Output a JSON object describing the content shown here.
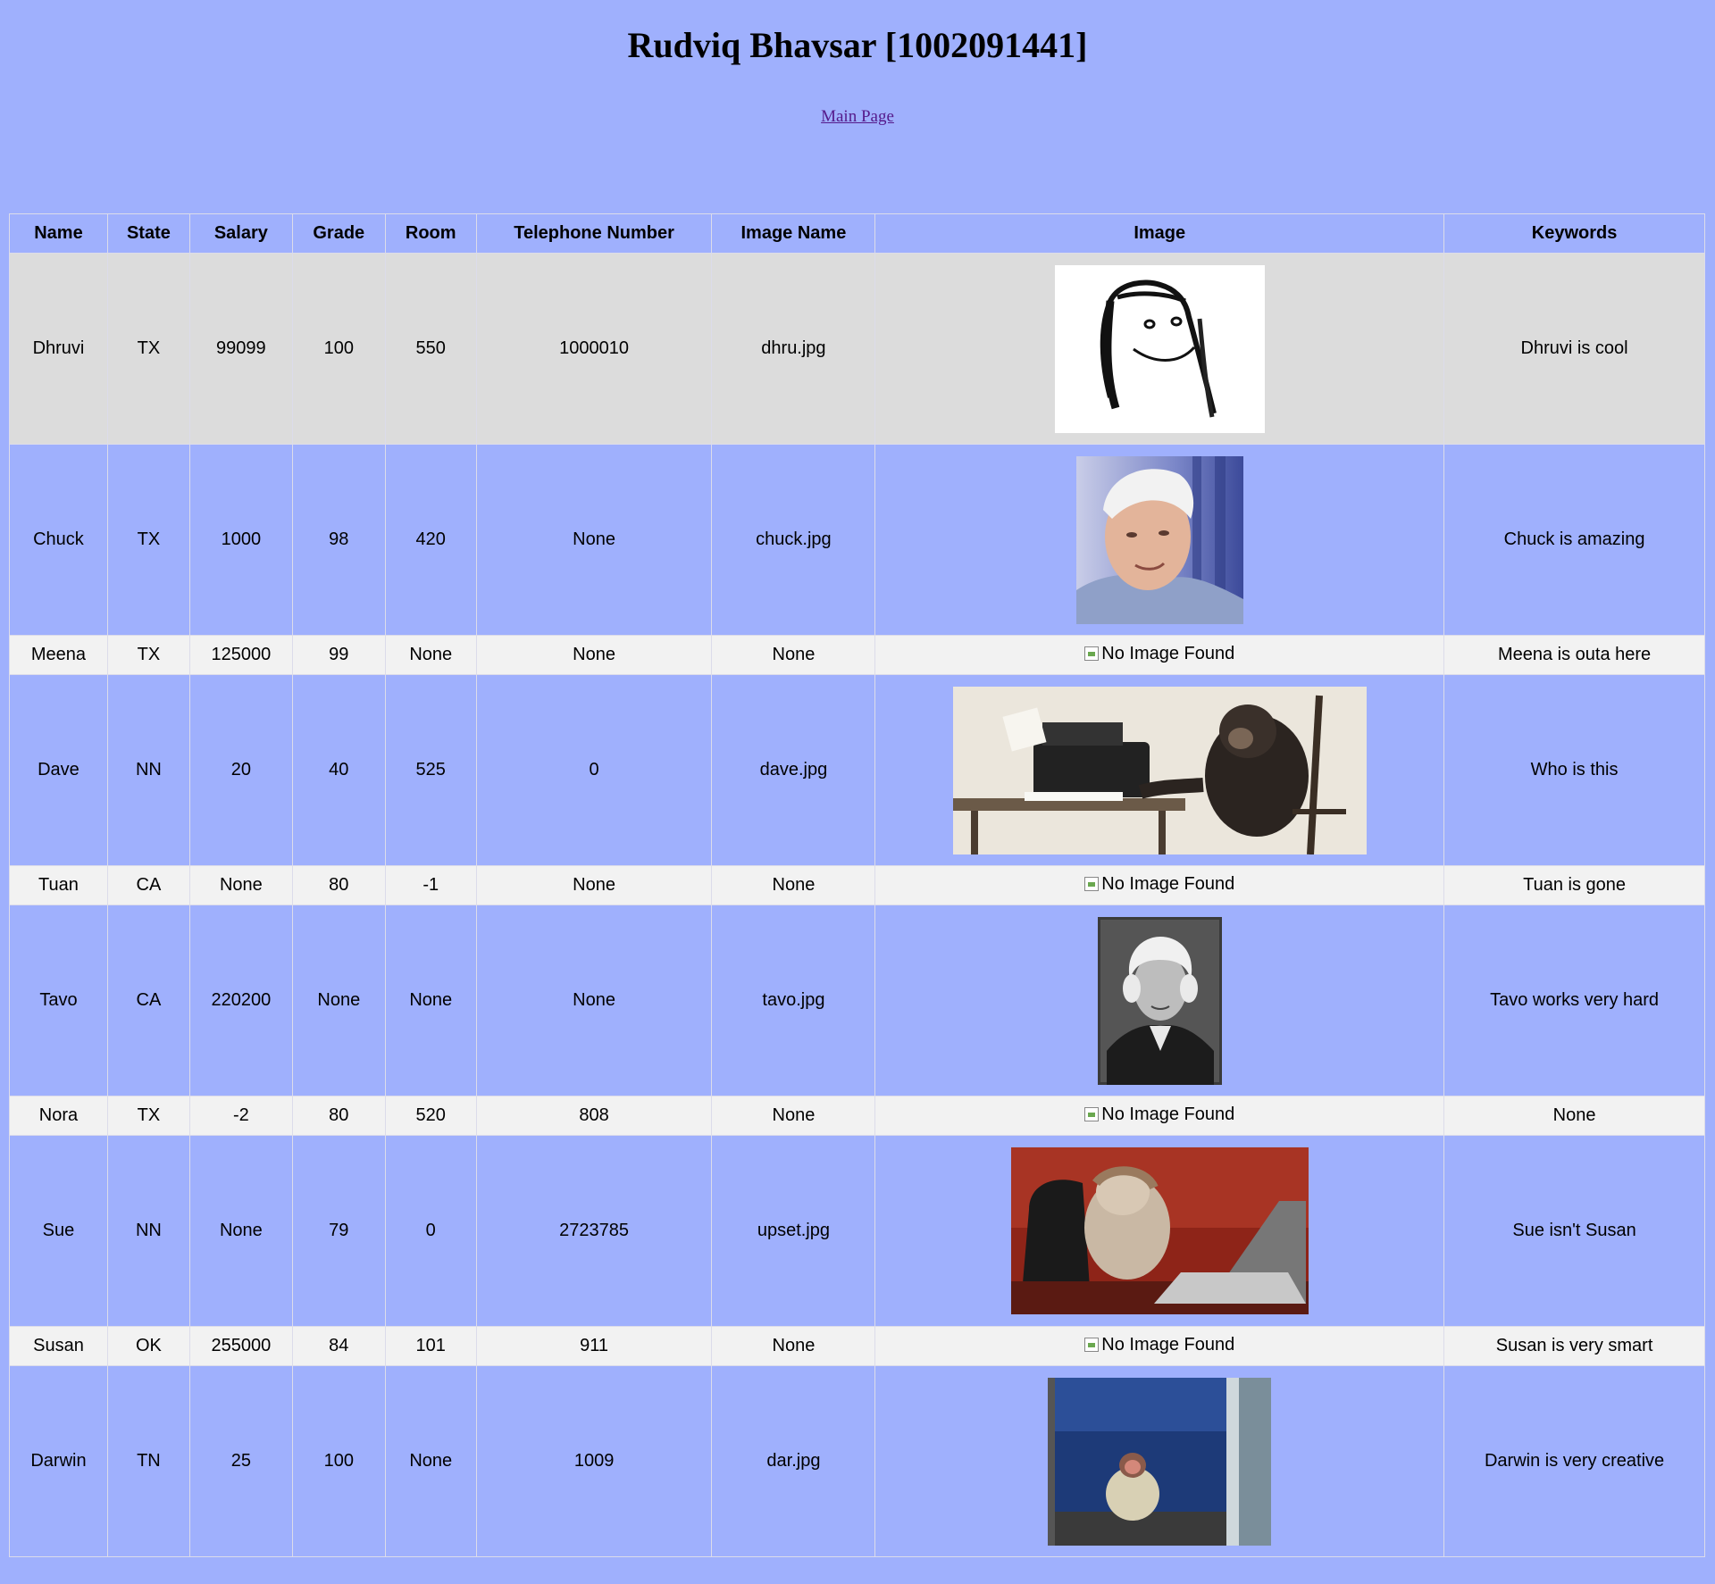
{
  "page": {
    "title": "Rudviq Bhavsar [1002091441]",
    "main_link": "Main Page"
  },
  "table": {
    "headers": [
      "Name",
      "State",
      "Salary",
      "Grade",
      "Room",
      "Telephone Number",
      "Image Name",
      "Image",
      "Keywords"
    ],
    "no_image_text": "No Image Found",
    "rows": [
      {
        "name": "Dhruvi",
        "state": "TX",
        "salary": "99099",
        "grade": "100",
        "room": "550",
        "phone": "1000010",
        "image_name": "dhru.jpg",
        "image": "hand-drawn-face-sketch",
        "keywords": "Dhruvi is cool"
      },
      {
        "name": "Chuck",
        "state": "TX",
        "salary": "1000",
        "grade": "98",
        "room": "420",
        "phone": "None",
        "image_name": "chuck.jpg",
        "image": "elderly-man-portrait-photo",
        "keywords": "Chuck is amazing"
      },
      {
        "name": "Meena",
        "state": "TX",
        "salary": "125000",
        "grade": "99",
        "room": "None",
        "phone": "None",
        "image_name": "None",
        "image": null,
        "keywords": "Meena is outa here"
      },
      {
        "name": "Dave",
        "state": "NN",
        "salary": "20",
        "grade": "40",
        "room": "525",
        "phone": "0",
        "image_name": "dave.jpg",
        "image": "chimp-at-typewriter-photo",
        "keywords": "Who is this"
      },
      {
        "name": "Tuan",
        "state": "CA",
        "salary": "None",
        "grade": "80",
        "room": "-1",
        "phone": "None",
        "image_name": "None",
        "image": null,
        "keywords": "Tuan is gone"
      },
      {
        "name": "Tavo",
        "state": "CA",
        "salary": "220200",
        "grade": "None",
        "room": "None",
        "phone": "None",
        "image_name": "tavo.jpg",
        "image": "engraved-portrait-old-man",
        "keywords": "Tavo works very hard"
      },
      {
        "name": "Nora",
        "state": "TX",
        "salary": "-2",
        "grade": "80",
        "room": "520",
        "phone": "808",
        "image_name": "None",
        "image": null,
        "keywords": "None"
      },
      {
        "name": "Sue",
        "state": "NN",
        "salary": "None",
        "grade": "79",
        "room": "0",
        "phone": "2723785",
        "image_name": "upset.jpg",
        "image": "upset-monkey-laptop-photo",
        "keywords": "Sue isn't Susan"
      },
      {
        "name": "Susan",
        "state": "OK",
        "salary": "255000",
        "grade": "84",
        "room": "101",
        "phone": "911",
        "image_name": "None",
        "image": null,
        "keywords": "Susan is very smart"
      },
      {
        "name": "Darwin",
        "state": "TN",
        "salary": "25",
        "grade": "100",
        "room": "None",
        "phone": "1009",
        "image_name": "dar.jpg",
        "image": "monkey-in-coat-photo",
        "keywords": "Darwin is very creative"
      }
    ]
  }
}
